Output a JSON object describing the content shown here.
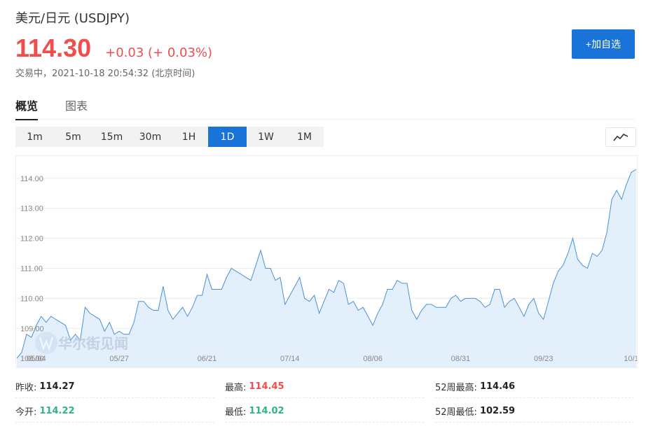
{
  "header": {
    "title": "美元/日元 (USDJPY)",
    "price": "114.30",
    "change": "+0.03 (+ 0.03%)",
    "status": "交易中，2021-10-18 20:54:32 (北京时间)",
    "add_label": "+加自选"
  },
  "tabs": [
    {
      "label": "概览"
    },
    {
      "label": "图表"
    }
  ],
  "ranges": [
    {
      "label": "1m"
    },
    {
      "label": "5m"
    },
    {
      "label": "15m"
    },
    {
      "label": "30m"
    },
    {
      "label": "1H"
    },
    {
      "label": "1D"
    },
    {
      "label": "1W"
    },
    {
      "label": "1M"
    }
  ],
  "active_range": "1D",
  "chart_type_icon": "line-chart-icon",
  "watermark": "华尔街见闻",
  "colors": {
    "up": "#f04d4d",
    "down": "#2fb38a",
    "accent": "#1a73d9",
    "line": "#4a90d9",
    "fill": "#e3f0fc"
  },
  "chart_data": {
    "type": "area",
    "ylim": [
      107.7,
      114.65
    ],
    "yticks": [
      108.0,
      109.0,
      110.0,
      111.0,
      112.0,
      113.0,
      114.0
    ],
    "ytick_labels": [
      "108.00",
      "109.00",
      "110.00",
      "111.00",
      "112.00",
      "113.00",
      "114.00"
    ],
    "xtick_labels": [
      {
        "label": "05/04",
        "at": 4
      },
      {
        "label": "05/27",
        "at": 21
      },
      {
        "label": "06/21",
        "at": 39
      },
      {
        "label": "07/14",
        "at": 56
      },
      {
        "label": "08/06",
        "at": 73
      },
      {
        "label": "08/31",
        "at": 91
      },
      {
        "label": "09/23",
        "at": 108
      },
      {
        "label": "10/1",
        "at": 126
      }
    ],
    "values": [
      108.0,
      108.2,
      108.8,
      108.7,
      109.1,
      109.4,
      109.2,
      109.4,
      109.3,
      109.2,
      109.1,
      108.6,
      108.8,
      108.6,
      109.7,
      109.5,
      109.4,
      109.3,
      108.9,
      109.2,
      108.8,
      108.9,
      108.8,
      108.8,
      109.2,
      109.9,
      109.9,
      109.7,
      109.6,
      109.6,
      110.4,
      109.6,
      109.3,
      109.5,
      109.7,
      109.4,
      109.7,
      110.1,
      110.1,
      110.8,
      110.3,
      110.3,
      110.3,
      110.7,
      111.0,
      110.9,
      110.8,
      110.7,
      110.6,
      111.1,
      111.6,
      111.0,
      111.0,
      110.6,
      110.7,
      109.8,
      110.1,
      110.4,
      110.7,
      110.0,
      109.9,
      110.1,
      109.5,
      109.9,
      110.3,
      110.2,
      110.6,
      110.5,
      109.8,
      109.9,
      109.6,
      109.7,
      109.4,
      109.1,
      109.5,
      109.8,
      110.3,
      110.3,
      110.6,
      110.5,
      110.5,
      109.6,
      109.3,
      109.6,
      109.8,
      109.8,
      109.7,
      109.7,
      109.7,
      110.0,
      110.1,
      109.9,
      110.0,
      110.0,
      110.0,
      109.9,
      109.7,
      109.8,
      110.3,
      110.3,
      109.7,
      109.9,
      110.0,
      109.7,
      109.4,
      109.8,
      110.0,
      109.5,
      109.3,
      109.9,
      110.5,
      110.9,
      111.1,
      111.5,
      112.0,
      111.3,
      111.1,
      111.0,
      111.5,
      111.4,
      111.6,
      112.2,
      113.3,
      113.6,
      113.3,
      113.8,
      114.2,
      114.3
    ]
  },
  "stats": [
    {
      "label": "昨收:",
      "value": "114.27",
      "tone": "neutral"
    },
    {
      "label": "最高:",
      "value": "114.45",
      "tone": "up"
    },
    {
      "label": "52周最高:",
      "value": "114.46",
      "tone": "neutral"
    },
    {
      "label": "今开:",
      "value": "114.22",
      "tone": "down"
    },
    {
      "label": "最低:",
      "value": "114.02",
      "tone": "down"
    },
    {
      "label": "52周最低:",
      "value": "102.59",
      "tone": "neutral"
    }
  ]
}
